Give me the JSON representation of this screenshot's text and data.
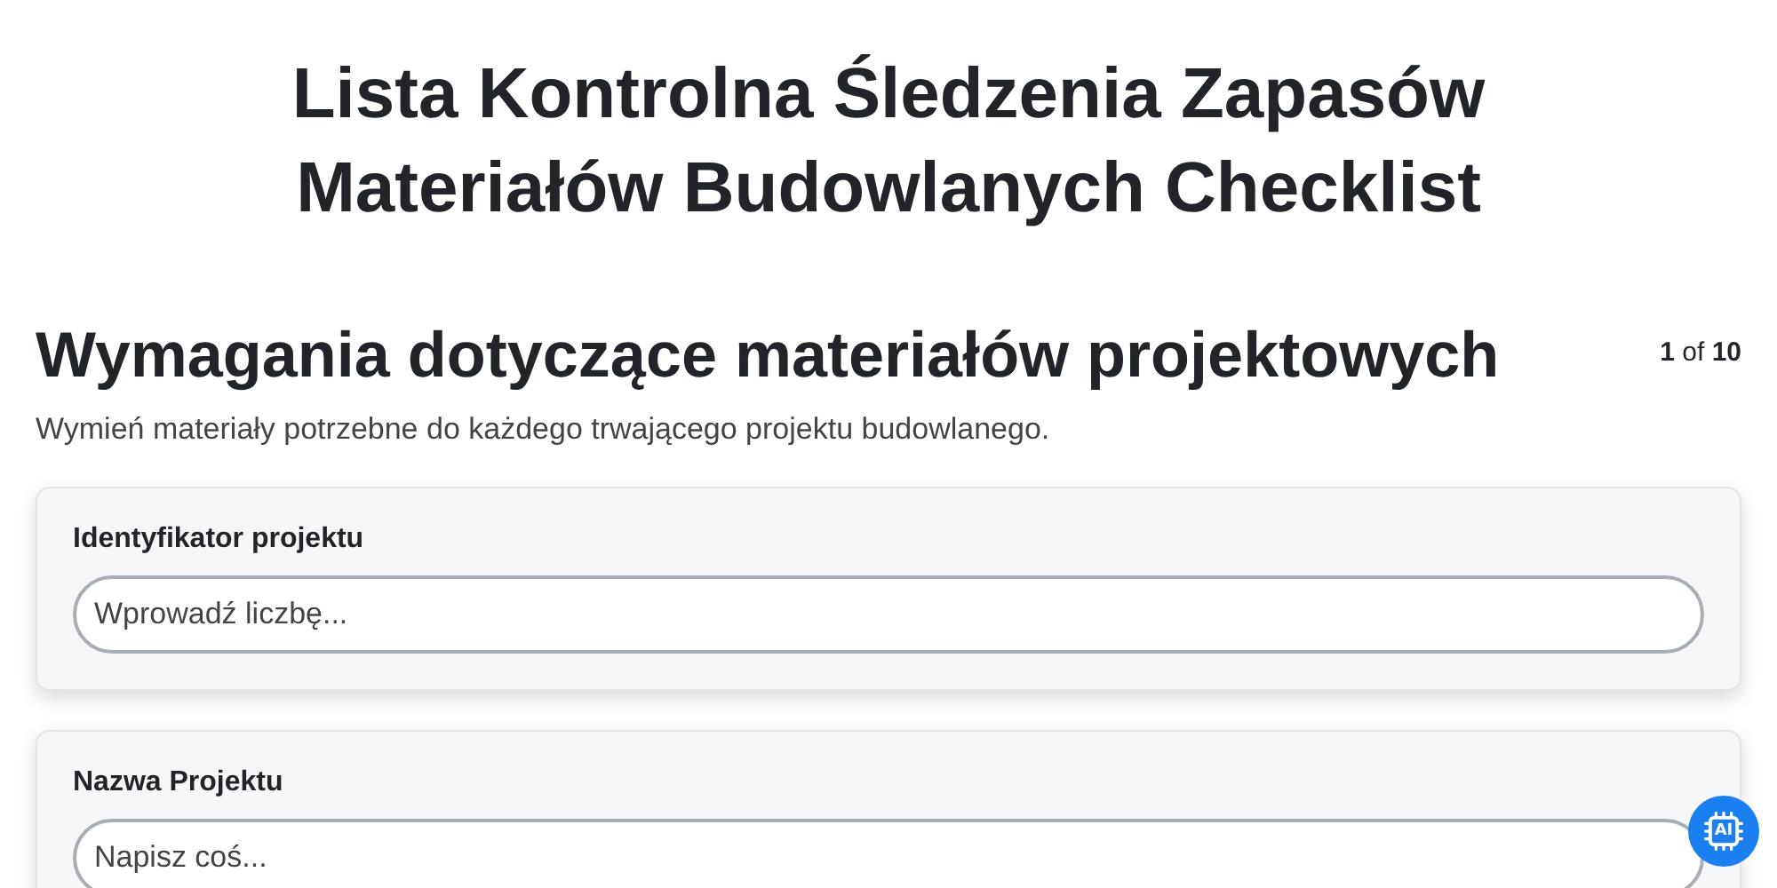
{
  "title": "Lista Kontrolna Śledzenia Zapasów Materiałów Budowlanych Checklist",
  "section": {
    "heading": "Wymagania dotyczące materiałów projektowych",
    "counter": "**1** of **10**",
    "description": "Wymień materiały potrzebne do każdego trwającego projektu budowlanego."
  },
  "fields": [
    {
      "label": "Identyfikator projektu",
      "placeholder": "Wprowadź liczbę..."
    },
    {
      "label": "Nazwa Projektu",
      "placeholder": "Napisz coś..."
    }
  ],
  "ai_button": {
    "label": "AI"
  }
}
